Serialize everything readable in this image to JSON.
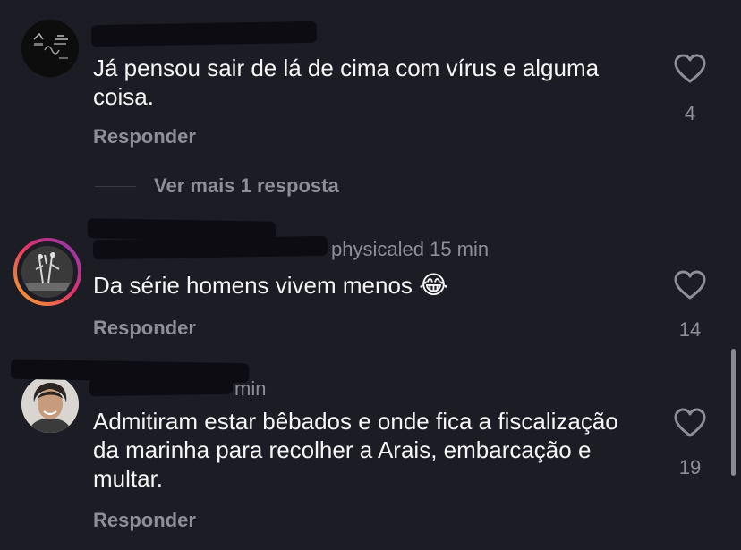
{
  "comments": [
    {
      "username": "",
      "time": "",
      "text": "Já pensou sair de lá de cima com vírus e alguma coisa.",
      "likes": "4",
      "reply_label": "Responder",
      "avatar_icon": "profile-photo-dark-logo"
    },
    {
      "username": "physicaled",
      "time": "15 min",
      "text": "Da série homens vivem menos",
      "emoji": "😂",
      "likes": "14",
      "reply_label": "Responder",
      "avatar_icon": "profile-photo-with-story-ring",
      "story_ring_colors": [
        "#f9a825",
        "#e1306c",
        "#833ab4"
      ]
    },
    {
      "username": "",
      "time": "min",
      "text": "Admitiram estar bêbados e onde fica a fiscalização da marinha para recolher a Arais, embarcação e multar.",
      "likes": "19",
      "reply_label": "Responder",
      "avatar_icon": "profile-photo-woman"
    }
  ],
  "thread": {
    "more_replies_label": "Ver mais 1 resposta"
  },
  "colors": {
    "background": "#1c1c24",
    "text": "#f5f5f5",
    "secondary": "#8e8e98",
    "redaction": "#0c0c12"
  },
  "icons": {
    "like": "heart-outline-icon"
  }
}
